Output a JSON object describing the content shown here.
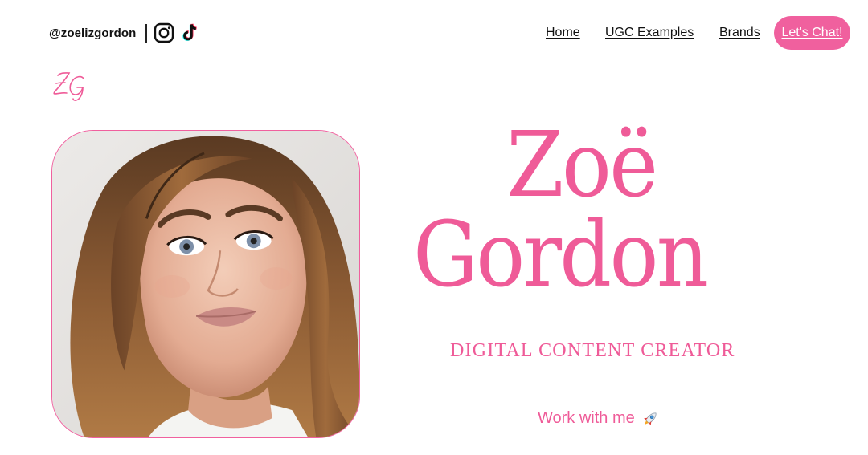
{
  "header": {
    "handle": "@zoelizgordon",
    "social": [
      {
        "icon": "instagram-icon"
      },
      {
        "icon": "tiktok-icon"
      }
    ],
    "nav": {
      "home": "Home",
      "ugc": "UGC Examples",
      "brands": "Brands",
      "chat_button": "Let's Chat!"
    }
  },
  "logo": {
    "monogram": "ZG",
    "icon": "zg-monogram-logo"
  },
  "hero": {
    "first_name": "Zoë",
    "last_name": "Gordon",
    "subtitle": "DIGITAL CONTENT CREATOR",
    "cta_label": "Work with me",
    "cta_icon": "rocket-icon"
  },
  "colors": {
    "accent": "#ef5b98",
    "button": "#f0609e",
    "text": "#111111",
    "background": "#ffffff"
  }
}
